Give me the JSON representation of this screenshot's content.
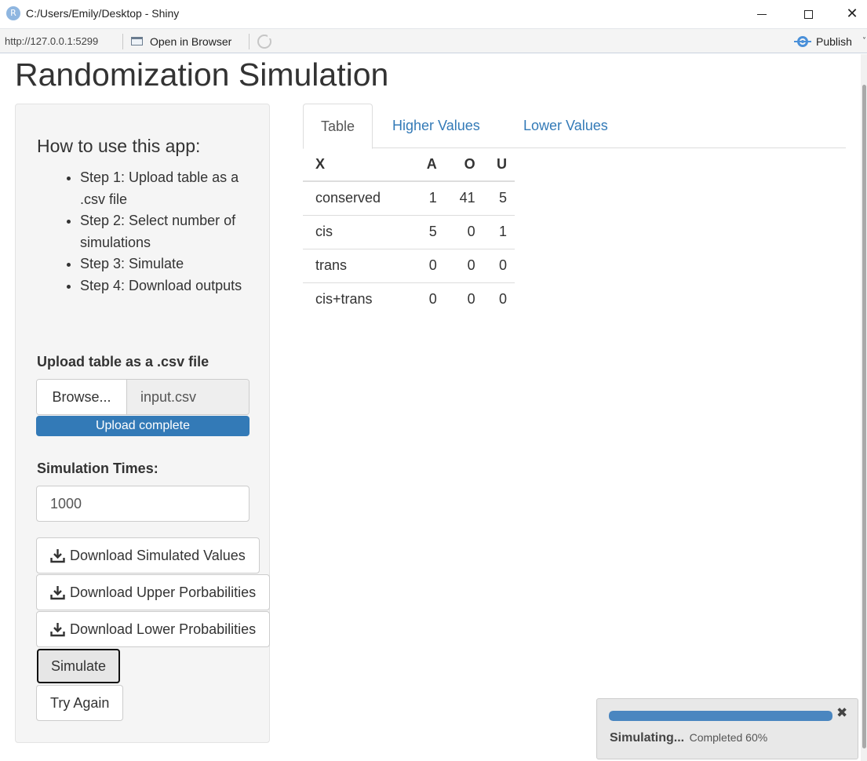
{
  "window": {
    "icon_letter": "R",
    "title": "C:/Users/Emily/Desktop - Shiny",
    "minimize_label": "",
    "close_glyph": "✕"
  },
  "toolbar": {
    "url": "http://127.0.0.1:5299",
    "open_in_browser": "Open in Browser",
    "publish": "Publish",
    "publish_caret": "˅"
  },
  "app": {
    "title": "Randomization Simulation"
  },
  "sidebar": {
    "help_title": "How to use this app:",
    "steps": [
      "Step 1: Upload table as a .csv file",
      "Step 2: Select number of simulations",
      "Step 3: Simulate",
      "Step 4: Download outputs"
    ],
    "upload_label": "Upload table as a .csv file",
    "browse_label": "Browse...",
    "file_name": "input.csv",
    "upload_status": "Upload complete",
    "sim_times_label": "Simulation Times:",
    "sim_times_value": "1000",
    "buttons": {
      "download_simulated": "Download Simulated Values",
      "download_upper": "Download Upper Porbabilities",
      "download_lower": "Download Lower Probabilities",
      "simulate": "Simulate",
      "try_again": "Try Again"
    }
  },
  "tabs": [
    {
      "label": "Table",
      "active": true
    },
    {
      "label": "Higher Values",
      "active": false
    },
    {
      "label": "Lower Values",
      "active": false
    }
  ],
  "table": {
    "headers": [
      "X",
      "A",
      "O",
      "U"
    ],
    "rows": [
      [
        "conserved",
        "1",
        "41",
        "5"
      ],
      [
        "cis",
        "5",
        "0",
        "1"
      ],
      [
        "trans",
        "0",
        "0",
        "0"
      ],
      [
        "cis+trans",
        "0",
        "0",
        "0"
      ]
    ]
  },
  "notification": {
    "message": "Simulating...",
    "detail": "Completed 60%",
    "progress": 0.6,
    "close_glyph": "✖"
  },
  "colors": {
    "link": "#337ab7",
    "upload_bar": "#337ab7",
    "progress": "#4a86c0",
    "publish_icon": "#4a90d9"
  }
}
